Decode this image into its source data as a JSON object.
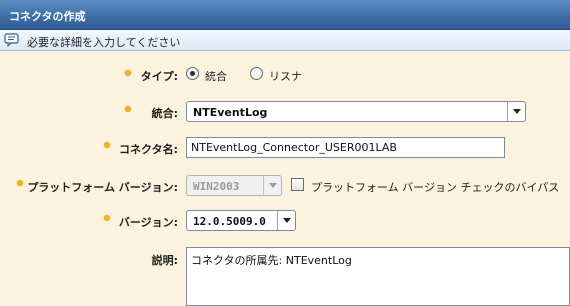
{
  "window": {
    "title": "コネクタの作成"
  },
  "info": {
    "text": "必要な詳細を入力してください",
    "icon": "message-icon"
  },
  "form": {
    "type": {
      "label": "タイプ:",
      "options": [
        {
          "label": "統合",
          "selected": true
        },
        {
          "label": "リスナ",
          "selected": false
        }
      ]
    },
    "integration": {
      "label": "統合:",
      "value": "NTEventLog"
    },
    "connector_name": {
      "label": "コネクタ名:",
      "value": "NTEventLog_Connector_USER001LAB"
    },
    "platform_version": {
      "label": "プラットフォーム バージョン:",
      "value": "WIN2003",
      "disabled": true,
      "bypass_check_label": "プラットフォーム バージョン チェックのバイパス",
      "bypass_checked": false
    },
    "version": {
      "label": "バージョン:",
      "value": "12.0.5009.0"
    },
    "description": {
      "label": "説明:",
      "value": "コネクタの所属先: NTEventLog"
    }
  },
  "colors": {
    "title_bar": "#3f6fa8",
    "background": "#fbf3dd",
    "required_marker": "#f0b31a"
  }
}
